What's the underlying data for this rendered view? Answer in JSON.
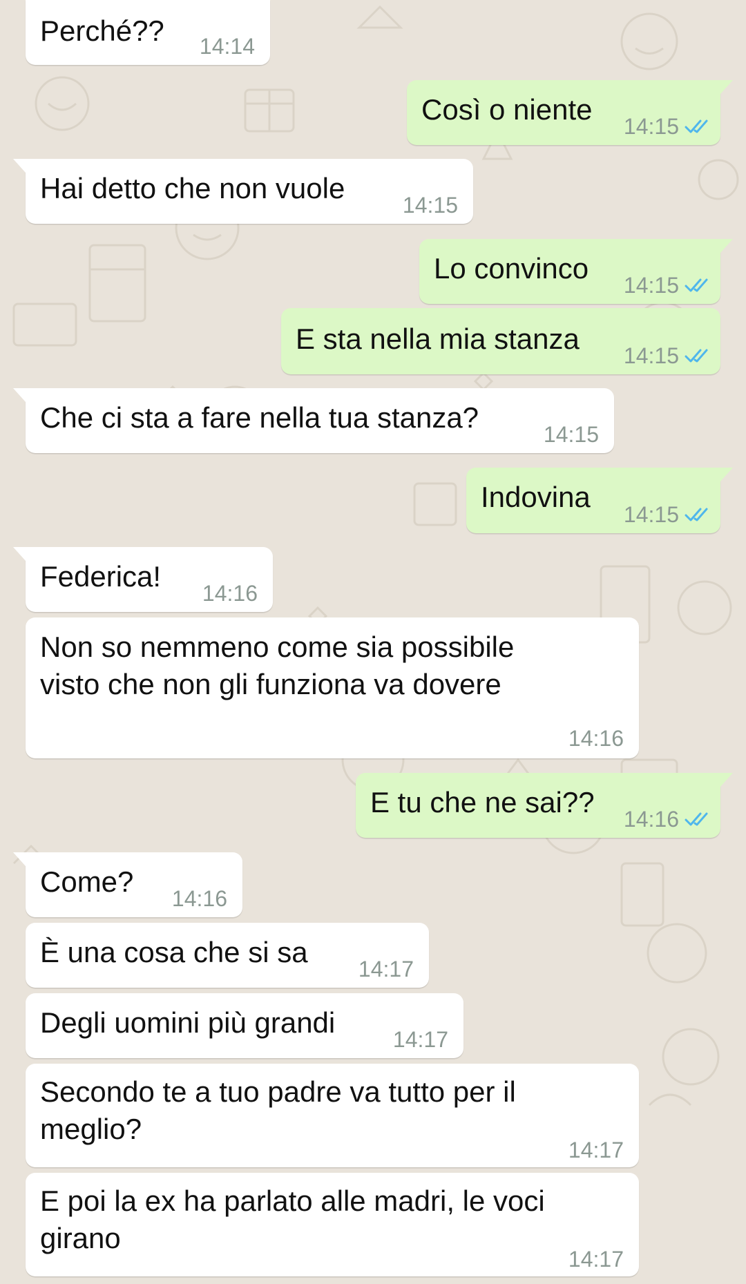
{
  "colors": {
    "wallpaper": "#e9e3da",
    "incoming_bubble": "#ffffff",
    "outgoing_bubble": "#dcf8c6",
    "timestamp": "#8b9892",
    "read_ticks": "#4fb6ec"
  },
  "status_icon": "double-check-read-icon",
  "messages": [
    {
      "dir": "in",
      "text": "Perché??",
      "time": "14:14"
    },
    {
      "dir": "out",
      "text": "Così o niente",
      "time": "14:15",
      "status": "read"
    },
    {
      "dir": "in",
      "text": "Hai detto che non vuole",
      "time": "14:15"
    },
    {
      "dir": "out",
      "text": "Lo convinco",
      "time": "14:15",
      "status": "read"
    },
    {
      "dir": "out",
      "text": "E sta nella mia stanza",
      "time": "14:15",
      "status": "read"
    },
    {
      "dir": "in",
      "text": "Che ci sta a fare nella tua stanza?",
      "time": "14:15"
    },
    {
      "dir": "out",
      "text": "Indovina",
      "time": "14:15",
      "status": "read"
    },
    {
      "dir": "in",
      "text": "Federica!",
      "time": "14:16"
    },
    {
      "dir": "in",
      "text": "Non so nemmeno come sia possibile\nvisto che non gli funziona va dovere",
      "time": "14:16"
    },
    {
      "dir": "out",
      "text": "E tu che ne sai??",
      "time": "14:16",
      "status": "read"
    },
    {
      "dir": "in",
      "text": "Come?",
      "time": "14:16"
    },
    {
      "dir": "in",
      "text": "È una cosa che si sa",
      "time": "14:17"
    },
    {
      "dir": "in",
      "text": "Degli uomini più grandi",
      "time": "14:17"
    },
    {
      "dir": "in",
      "text": "Secondo te a tuo padre va tutto per il\nmeglio?",
      "time": "14:17"
    },
    {
      "dir": "in",
      "text": "E poi la ex ha parlato alle madri, le voci\ngirano",
      "time": "14:17"
    }
  ]
}
